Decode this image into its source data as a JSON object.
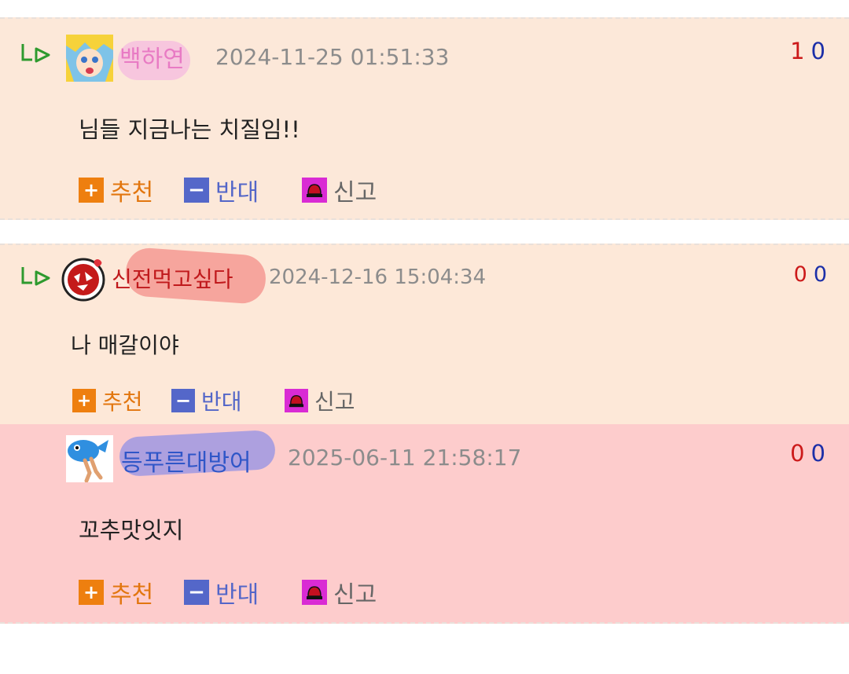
{
  "comments": [
    {
      "nickname": "백하연",
      "date": "2024-11-25 01:51:33",
      "votes_up": "1",
      "votes_down": "0",
      "content": "님들 지금나는 치질임!!",
      "is_reply": true
    },
    {
      "nickname": "신전먹고싶다",
      "date": "2024-12-16 15:04:34",
      "votes_up": "0",
      "votes_down": "0",
      "content": "나 매갈이야",
      "is_reply": true
    },
    {
      "nickname": "등푸른대방어",
      "date": "2025-06-11 21:58:17",
      "votes_up": "0",
      "votes_down": "0",
      "content": "꼬추맛잇지",
      "is_reply": false
    }
  ],
  "actions": {
    "recommend_label": "추천",
    "oppose_label": "반대",
    "report_label": "신고",
    "recommend_icon": "plus-icon",
    "oppose_icon": "minus-icon",
    "report_icon": "siren-icon"
  },
  "colors": {
    "comment1_bg": "#fce8d9",
    "comment2_bg": "#fde8d8",
    "comment3_bg": "#fdcccc",
    "recommend": "#ee7f0f",
    "oppose": "#5467c9",
    "report": "#d92bd4",
    "vote_up": "#cc1a1a",
    "vote_down": "#1c2fa8",
    "nick1": "#e87bc4",
    "nick2": "#c0191c",
    "nick3": "#2f56c8"
  }
}
